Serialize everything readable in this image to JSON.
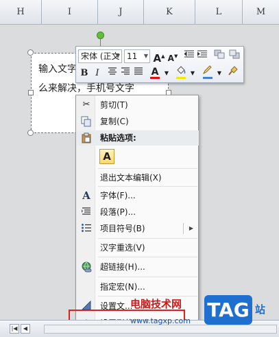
{
  "columns": [
    {
      "key": "H",
      "label": "H"
    },
    {
      "key": "I",
      "label": "I"
    },
    {
      "key": "J",
      "label": "J"
    },
    {
      "key": "K",
      "label": "K"
    },
    {
      "key": "L",
      "label": "L"
    },
    {
      "key": "M",
      "label": "M"
    }
  ],
  "textbox": {
    "line1": "输入文字",
    "line2": "么来解决，手机号文字"
  },
  "mini_toolbar": {
    "font_name": "宋体 (正文",
    "font_size": "11",
    "grow_font": "A",
    "shrink_font": "A",
    "bold": "B",
    "italic": "I",
    "font_color_glyph": "A"
  },
  "context_menu": {
    "cut": "剪切(T)",
    "copy": "复制(C)",
    "paste_options": "粘贴选项:",
    "paste_keep_text": "A",
    "exit_text_edit": "退出文本编辑(X)",
    "font": "字体(F)...",
    "paragraph": "段落(P)...",
    "bullets": "项目符号(B)",
    "hanja": "汉字重选(V)",
    "hyperlink": "超链接(H)...",
    "assign_macro": "指定宏(N)...",
    "set_default_text": "设置文...",
    "format_shape": "设置形状格式(O)..."
  },
  "watermark": {
    "site_name": "电脑技术网",
    "site_url": "www.tagxp.com",
    "tag": "TAG",
    "station": "站"
  },
  "colors": {
    "highlight": "#e0211b",
    "rotation_handle": "#5fc040",
    "font_color_bar": "#e01010",
    "highlight_color_bar": "#f2e80c",
    "line_color_bar": "#4a7ed0"
  }
}
